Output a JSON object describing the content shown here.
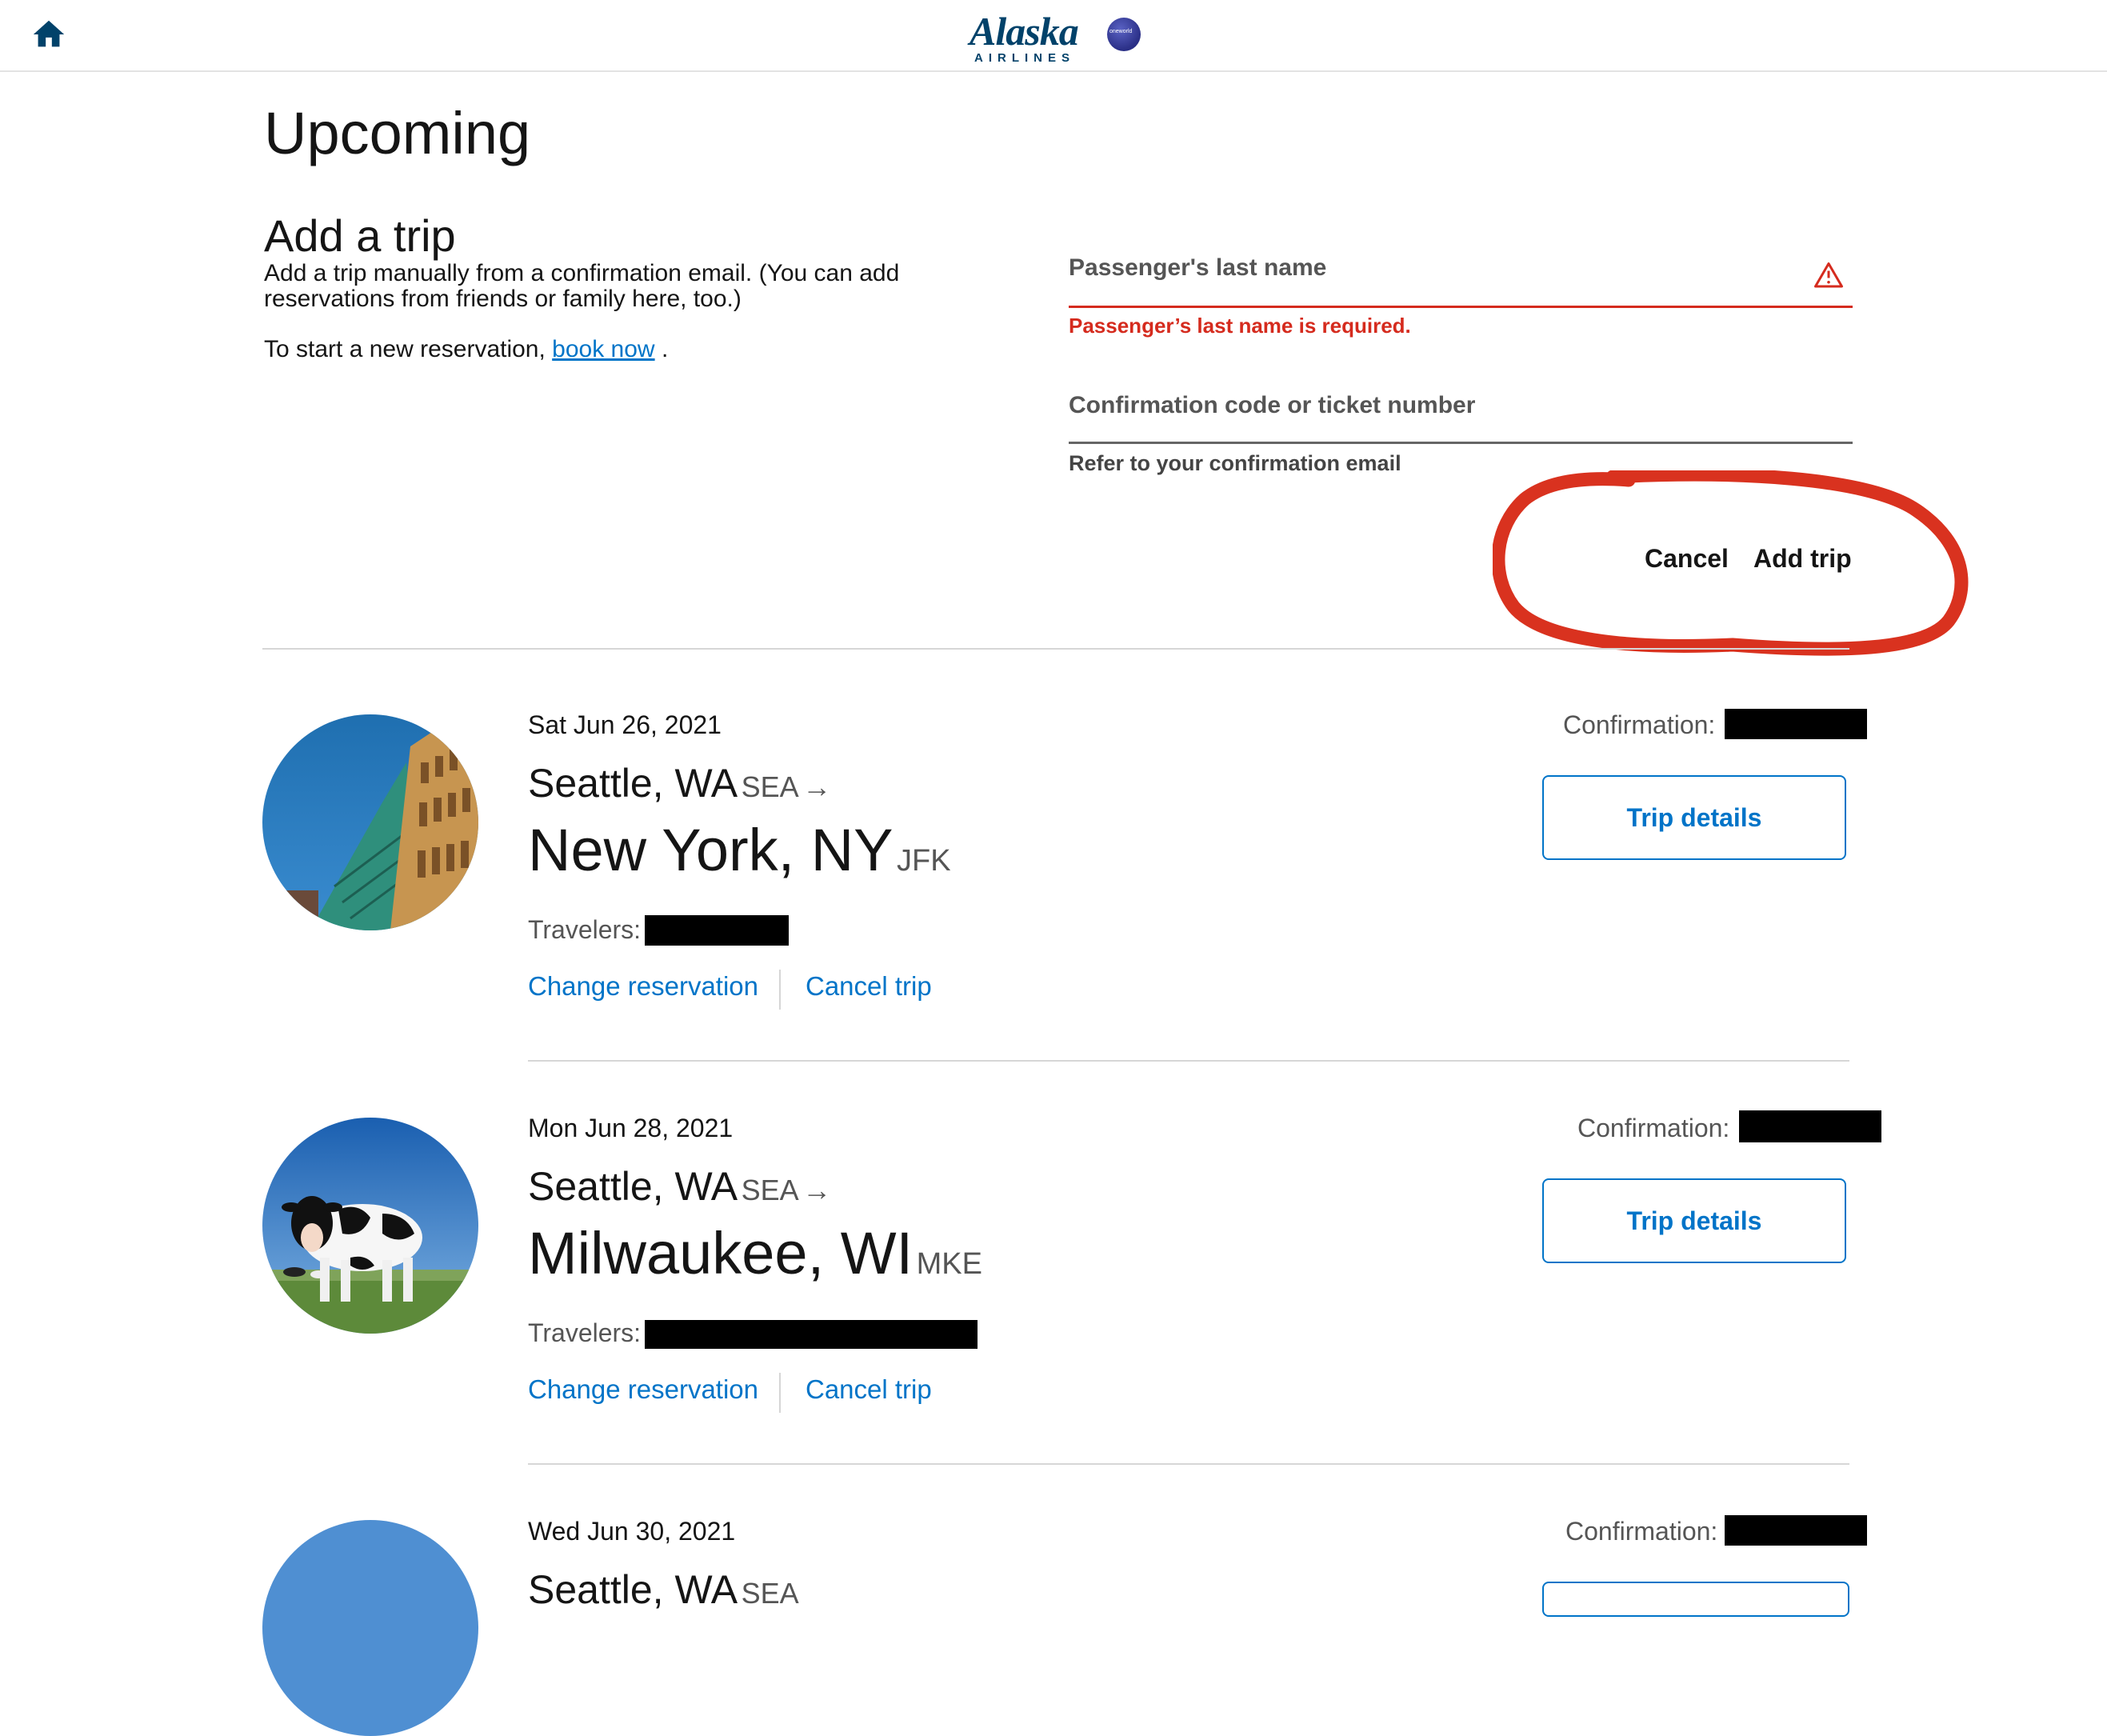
{
  "header": {
    "logo_text": "Alaska",
    "logo_subtext": "AIRLINES",
    "oneworld_text": "oneworld",
    "brand_color": "#01426a"
  },
  "page_title": "Upcoming",
  "add_trip": {
    "heading": "Add a trip",
    "description": "Add a trip manually from a confirmation email. (You can add reservations from friends or family here, too.)",
    "new_reservation_prefix": "To start a new reservation, ",
    "book_now_link": "book now",
    "new_reservation_suffix": " .",
    "last_name_label": "Passenger's last name",
    "last_name_value": "",
    "last_name_error": "Passenger’s last name is required.",
    "confirmation_label": "Confirmation code or ticket number",
    "confirmation_value": "",
    "confirmation_hint": "Refer to your confirmation email",
    "cancel_label": "Cancel",
    "add_trip_label": "Add trip",
    "error_color": "#d52b1e",
    "annotation_color": "#d9321f"
  },
  "trips": [
    {
      "date": "Sat Jun 26, 2021",
      "origin_city": "Seattle, WA",
      "origin_code": "SEA",
      "dest_city": "New York, NY",
      "dest_code": "JFK",
      "travelers_label": "Travelers:",
      "confirmation_label": "Confirmation:",
      "details_label": "Trip details",
      "change_label": "Change reservation",
      "cancel_label": "Cancel trip"
    },
    {
      "date": "Mon Jun 28, 2021",
      "origin_city": "Seattle, WA",
      "origin_code": "SEA",
      "dest_city": "Milwaukee, WI",
      "dest_code": "MKE",
      "travelers_label": "Travelers:",
      "confirmation_label": "Confirmation:",
      "details_label": "Trip details",
      "change_label": "Change reservation",
      "cancel_label": "Cancel trip"
    },
    {
      "date": "Wed Jun 30, 2021",
      "origin_city": "Seattle, WA",
      "origin_code": "SEA",
      "confirmation_label": "Confirmation:"
    }
  ],
  "link_color": "#0074c8"
}
